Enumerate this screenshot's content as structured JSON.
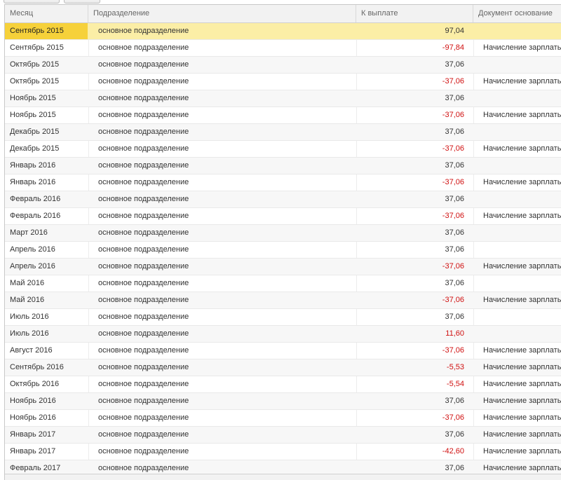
{
  "columns": {
    "month": "Месяц",
    "department": "Подразделение",
    "payout": "К выплате",
    "document": "Документ основание"
  },
  "rows": [
    {
      "month": "Сентябрь 2015",
      "department": "основное подразделение",
      "payout": "97,04",
      "document": "",
      "negative": false,
      "selected": true
    },
    {
      "month": "Сентябрь 2015",
      "department": "основное подразделение",
      "payout": "-97,84",
      "document": "Начисление зарплаты",
      "negative": true
    },
    {
      "month": "Октябрь 2015",
      "department": "основное подразделение",
      "payout": "37,06",
      "document": "",
      "negative": false
    },
    {
      "month": "Октябрь 2015",
      "department": "основное подразделение",
      "payout": "-37,06",
      "document": "Начисление зарплаты",
      "negative": true
    },
    {
      "month": "Ноябрь 2015",
      "department": "основное подразделение",
      "payout": "37,06",
      "document": "",
      "negative": false
    },
    {
      "month": "Ноябрь 2015",
      "department": "основное подразделение",
      "payout": "-37,06",
      "document": "Начисление зарплаты",
      "negative": true
    },
    {
      "month": "Декабрь 2015",
      "department": "основное подразделение",
      "payout": "37,06",
      "document": "",
      "negative": false
    },
    {
      "month": "Декабрь 2015",
      "department": "основное подразделение",
      "payout": "-37,06",
      "document": "Начисление зарплаты",
      "negative": true
    },
    {
      "month": "Январь 2016",
      "department": "основное подразделение",
      "payout": "37,06",
      "document": "",
      "negative": false
    },
    {
      "month": "Январь 2016",
      "department": "основное подразделение",
      "payout": "-37,06",
      "document": "Начисление зарплаты",
      "negative": true
    },
    {
      "month": "Февраль 2016",
      "department": "основное подразделение",
      "payout": "37,06",
      "document": "",
      "negative": false
    },
    {
      "month": "Февраль 2016",
      "department": "основное подразделение",
      "payout": "-37,06",
      "document": "Начисление зарплаты",
      "negative": true
    },
    {
      "month": "Март 2016",
      "department": "основное подразделение",
      "payout": "37,06",
      "document": "",
      "negative": false
    },
    {
      "month": "Апрель 2016",
      "department": "основное подразделение",
      "payout": "37,06",
      "document": "",
      "negative": false
    },
    {
      "month": "Апрель 2016",
      "department": "основное подразделение",
      "payout": "-37,06",
      "document": "Начисление зарплаты",
      "negative": true
    },
    {
      "month": "Май 2016",
      "department": "основное подразделение",
      "payout": "37,06",
      "document": "",
      "negative": false
    },
    {
      "month": "Май 2016",
      "department": "основное подразделение",
      "payout": "-37,06",
      "document": "Начисление зарплаты",
      "negative": true
    },
    {
      "month": "Июль 2016",
      "department": "основное подразделение",
      "payout": "37,06",
      "document": "",
      "negative": false
    },
    {
      "month": "Июль 2016",
      "department": "основное подразделение",
      "payout": "11,60",
      "document": "",
      "negative": true
    },
    {
      "month": "Август 2016",
      "department": "основное подразделение",
      "payout": "-37,06",
      "document": "Начисление зарплаты",
      "negative": true
    },
    {
      "month": "Сентябрь 2016",
      "department": "основное подразделение",
      "payout": "-5,53",
      "document": "Начисление зарплаты",
      "negative": true
    },
    {
      "month": "Октябрь 2016",
      "department": "основное подразделение",
      "payout": "-5,54",
      "document": "Начисление зарплаты",
      "negative": true
    },
    {
      "month": "Ноябрь 2016",
      "department": "основное подразделение",
      "payout": "37,06",
      "document": "Начисление зарплаты",
      "negative": false
    },
    {
      "month": "Ноябрь 2016",
      "department": "основное подразделение",
      "payout": "-37,06",
      "document": "Начисление зарплаты",
      "negative": true
    },
    {
      "month": "Январь 2017",
      "department": "основное подразделение",
      "payout": "37,06",
      "document": "Начисление зарплаты",
      "negative": false
    },
    {
      "month": "Январь 2017",
      "department": "основное подразделение",
      "payout": "-42,60",
      "document": "Начисление зарплаты",
      "negative": true
    },
    {
      "month": "Февраль 2017",
      "department": "основное подразделение",
      "payout": "37,06",
      "document": "Начисление зарплаты",
      "negative": false
    }
  ],
  "colors": {
    "selected_row": "#fbeea6",
    "selected_cell": "#f6d13a",
    "negative_value": "#d01010",
    "header_bg": "#f2f2f2"
  }
}
